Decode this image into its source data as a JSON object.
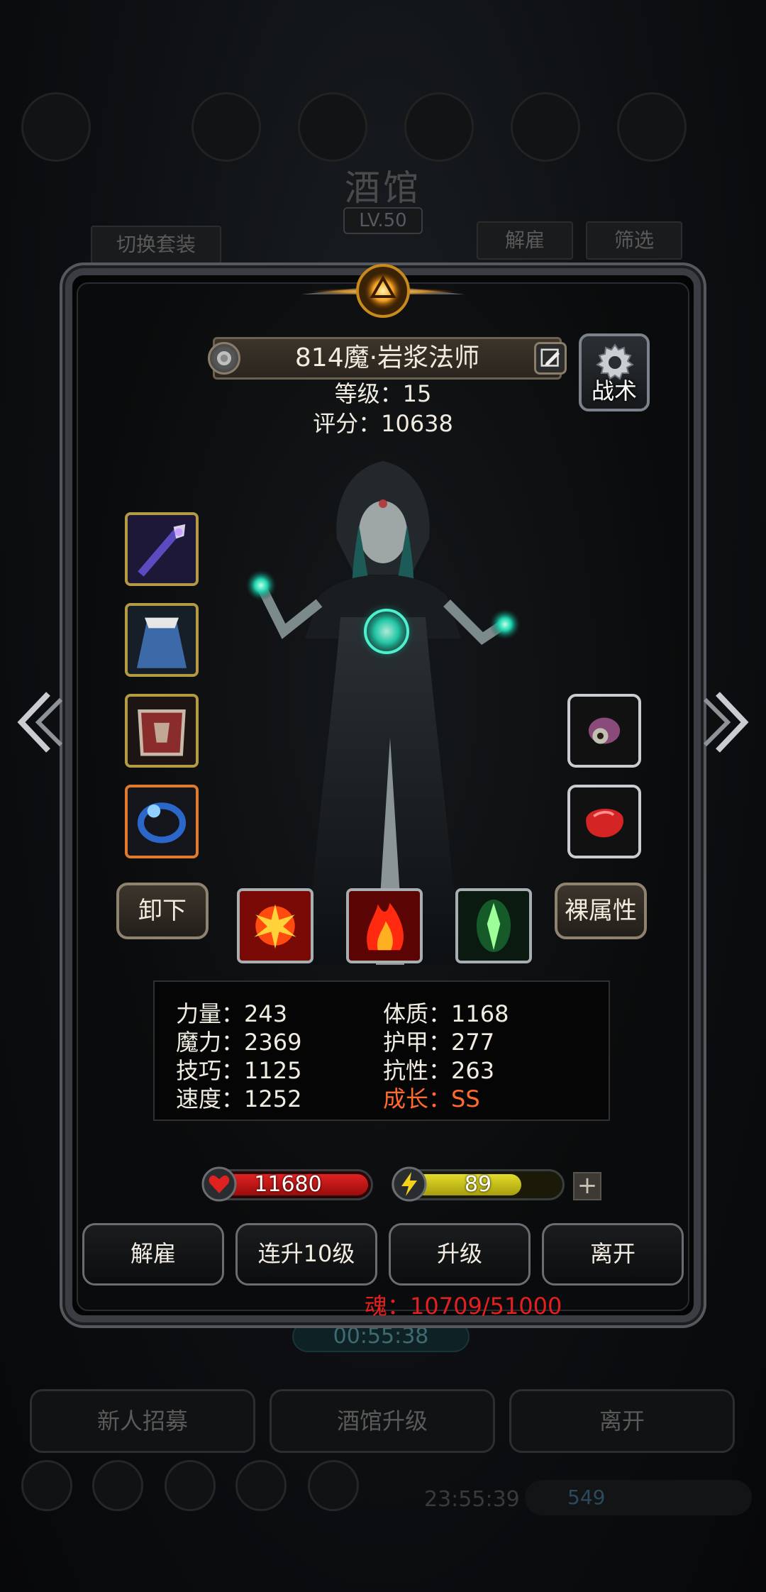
{
  "background": {
    "title": "酒馆",
    "level": "LV.50",
    "switch_set": "切换套装",
    "dismiss": "解雇",
    "filter": "筛选",
    "timer": "00:55:38",
    "bottom_buttons": [
      "新人招募",
      "酒馆升级",
      "离开"
    ],
    "bottom_timer": "23:55:39",
    "bottom_count": "549"
  },
  "hero": {
    "name": "814魔·岩浆法师",
    "level_line": "等级：15",
    "score_line": "评分：10638"
  },
  "tactics_label": "战术",
  "unequip_label": "卸下",
  "bare_stats_label": "裸属性",
  "equipment": {
    "left": [
      {
        "icon": "staff-icon",
        "rarity": "gold"
      },
      {
        "icon": "cloak-icon",
        "rarity": "gold"
      },
      {
        "icon": "chest-armor-icon",
        "rarity": "gold"
      },
      {
        "icon": "ring-icon",
        "rarity": "orange"
      }
    ],
    "right": [
      {
        "icon": "eye-gem-icon"
      },
      {
        "icon": "red-stone-icon"
      }
    ]
  },
  "skills": [
    "fire-burst-icon",
    "flame-icon",
    "green-crystal-icon"
  ],
  "stats": {
    "str": "力量：243",
    "con": "体质：1168",
    "mag": "魔力：2369",
    "armor": "护甲：277",
    "skill": "技巧：1125",
    "resist": "抗性：263",
    "speed": "速度：1252",
    "growth": "成长：SS"
  },
  "hp": {
    "value": "11680",
    "fill": 1.0
  },
  "mp": {
    "value": "89",
    "fill": 0.76
  },
  "plus": "+",
  "actions": [
    "解雇",
    "连升10级",
    "升级",
    "离开"
  ],
  "soul": "魂：10709/51000",
  "colors": {
    "growth": "#ff6a2e",
    "soul": "#e3201f",
    "hp": "#e02222",
    "mp": "#e3dc2a"
  }
}
